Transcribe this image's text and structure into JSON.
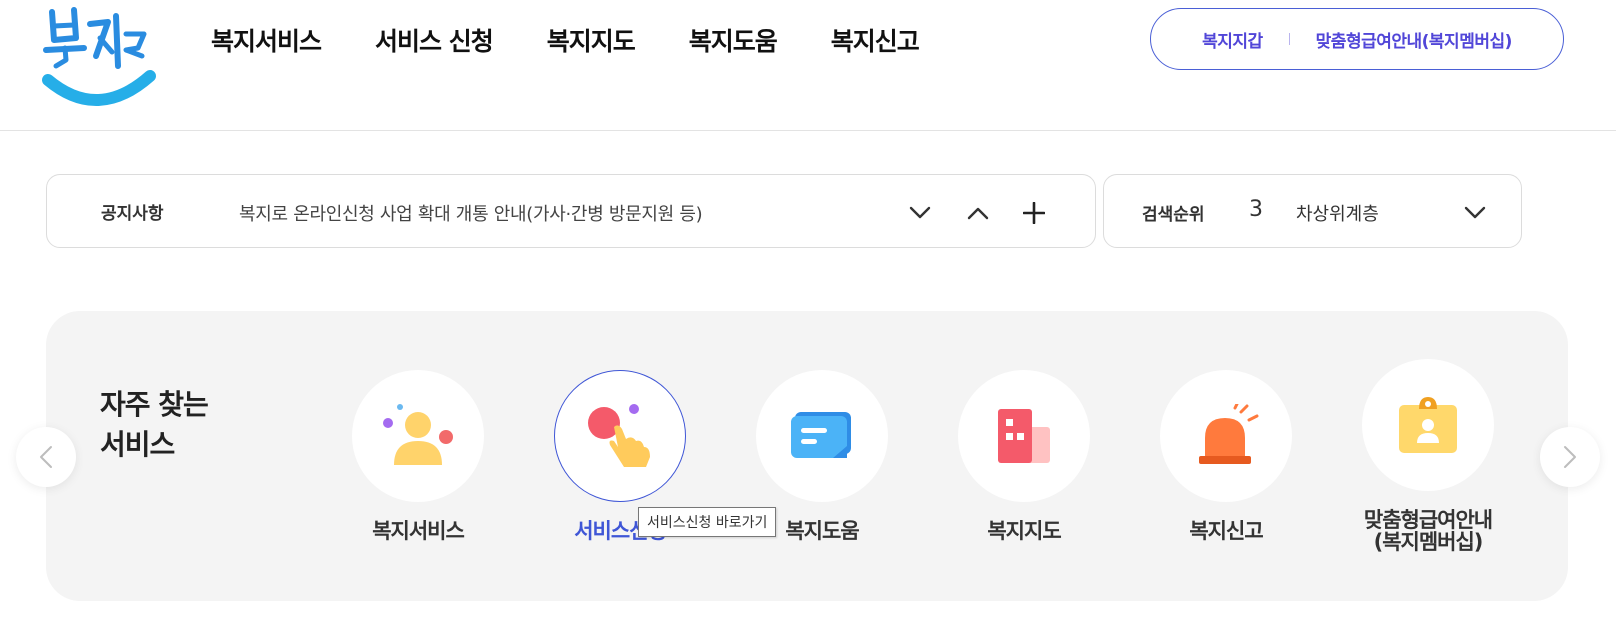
{
  "header": {
    "logo_text": "복지로",
    "nav": [
      "복지서비스",
      "서비스 신청",
      "복지지도",
      "복지도움",
      "복지신고"
    ],
    "util_links": [
      "복지지갑",
      "맞춤형급여안내(복지멤버십)"
    ],
    "accent_color": "#5146d8"
  },
  "notice": {
    "label": "공지사항",
    "text": "복지로 온라인신청 사업 확대 개통 안내(가사·간병 방문지원 등)",
    "controls": [
      "chevron-down",
      "chevron-up",
      "plus"
    ]
  },
  "search_rank": {
    "label": "검색순위",
    "rank": "3",
    "term": "차상위계층"
  },
  "quick": {
    "title_line1": "자주 찾는",
    "title_line2": "서비스",
    "items": [
      {
        "label": "복지서비스",
        "icon": "people-icon"
      },
      {
        "label": "서비스신청",
        "icon": "hand-tap-icon",
        "active": true
      },
      {
        "label": "복지도움",
        "icon": "chat-icon"
      },
      {
        "label": "복지지도",
        "icon": "building-icon"
      },
      {
        "label": "복지신고",
        "icon": "siren-icon"
      },
      {
        "label_line1": "맞춤형급여안내",
        "label_line2": "(복지멤버십)",
        "icon": "id-badge-icon"
      }
    ],
    "tooltip": "서비스신청 바로가기",
    "active_color": "#3f56d6"
  }
}
